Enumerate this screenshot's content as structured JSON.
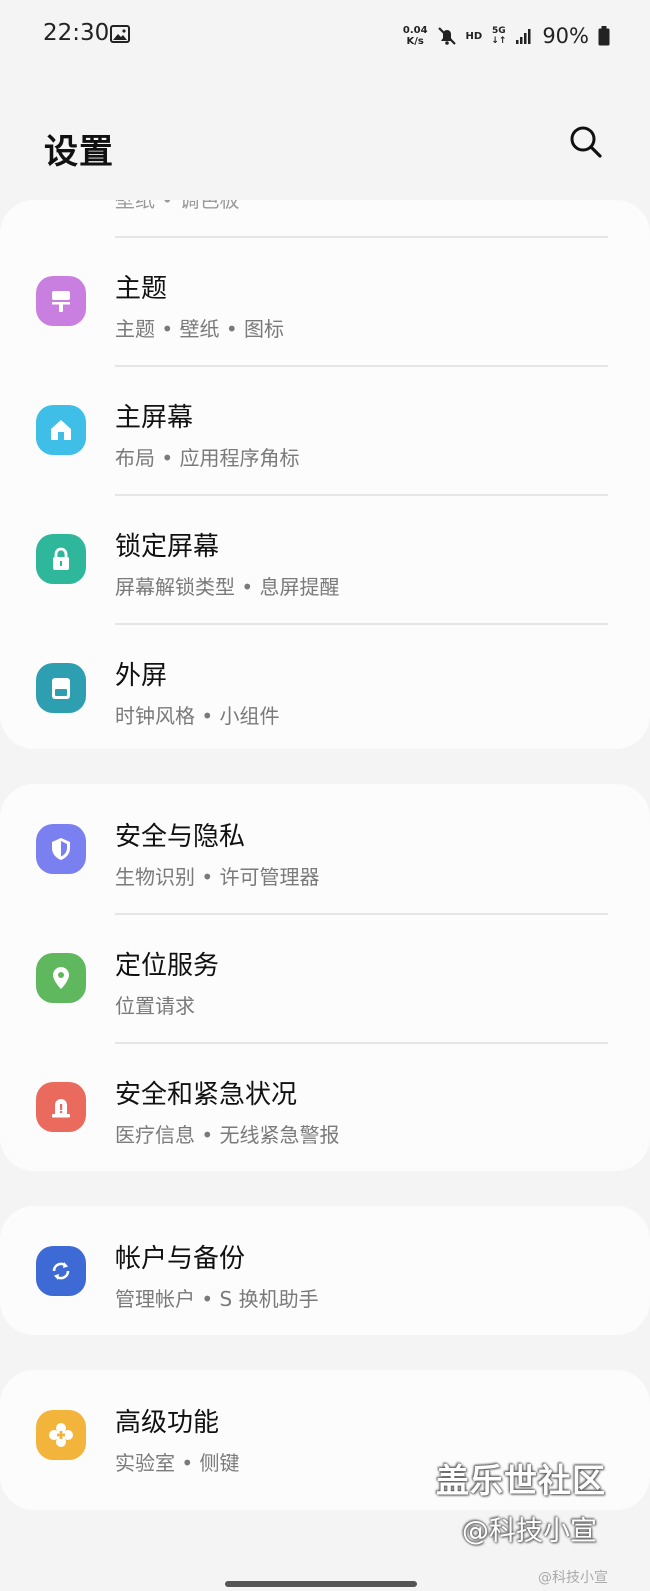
{
  "status_bar": {
    "time": "22:30",
    "net_speed_value": "0.04",
    "net_speed_unit": "K/s",
    "hd": "HD",
    "network": "5G",
    "battery": "90%"
  },
  "header": {
    "title": "设置"
  },
  "partial_row": {
    "subtitle": "壁纸 • 调色板"
  },
  "cards": [
    {
      "rows": [
        {
          "title": "主题",
          "subtitle": "主题 • 壁纸 • 图标",
          "icon": "paint-brush-icon",
          "color": "#c97fe0"
        },
        {
          "title": "主屏幕",
          "subtitle": "布局 • 应用程序角标",
          "icon": "home-icon",
          "color": "#3fbfe8"
        },
        {
          "title": "锁定屏幕",
          "subtitle": "屏幕解锁类型 • 息屏提醒",
          "icon": "lock-icon",
          "color": "#2fb79b"
        },
        {
          "title": "外屏",
          "subtitle": "时钟风格 • 小组件",
          "icon": "cover-screen-icon",
          "color": "#2e9fb1"
        }
      ]
    },
    {
      "rows": [
        {
          "title": "安全与隐私",
          "subtitle": "生物识别 • 许可管理器",
          "icon": "shield-icon",
          "color": "#7b80f0"
        },
        {
          "title": "定位服务",
          "subtitle": "位置请求",
          "icon": "location-pin-icon",
          "color": "#5fb85e"
        },
        {
          "title": "安全和紧急状况",
          "subtitle": "医疗信息 • 无线紧急警报",
          "icon": "emergency-light-icon",
          "color": "#ea6b5d"
        }
      ]
    },
    {
      "rows": [
        {
          "title": "帐户与备份",
          "subtitle": "管理帐户 • S 换机助手",
          "icon": "sync-icon",
          "color": "#3e6ad6"
        }
      ]
    },
    {
      "rows": [
        {
          "title": "高级功能",
          "subtitle": "实验室 • 侧键",
          "icon": "plus-gear-icon",
          "color": "#f2b43a"
        }
      ]
    }
  ],
  "watermark": {
    "line1": "盖乐世社区",
    "line2": "@科技小宣",
    "line3": "@科技小宣"
  }
}
